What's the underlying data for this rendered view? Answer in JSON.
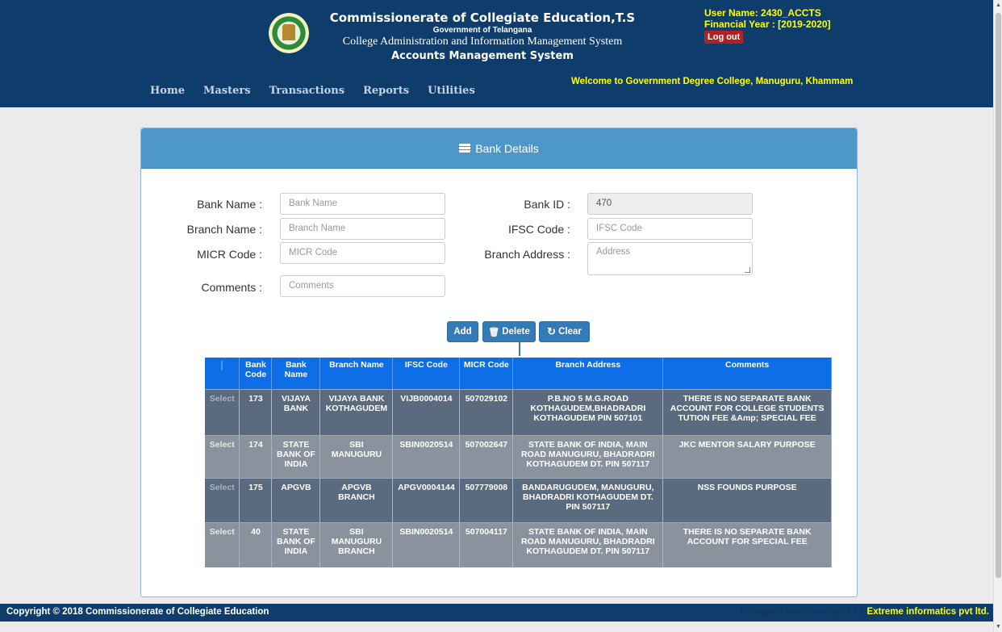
{
  "header": {
    "title": "Commissionerate of Collegiate Education,T.S",
    "government": "Government of Telangana",
    "system": "College Administration and Information Management System",
    "module": "Accounts Management System",
    "user_name": "User Name:  2430_ACCTS",
    "financial_year": "Financial Year :  [2019-2020]",
    "logout": "Log out",
    "welcome": "Welcome to  Government Degree College, Manuguru, Khammam"
  },
  "nav": [
    "Home",
    "Masters",
    "Transactions",
    "Reports",
    "Utilities"
  ],
  "panel": {
    "title": "Bank Details",
    "icon": "list-icon"
  },
  "form": {
    "bank_name": {
      "label": "Bank Name :",
      "placeholder": "Bank Name",
      "value": ""
    },
    "branch_name": {
      "label": "Branch Name :",
      "placeholder": "Branch Name",
      "value": ""
    },
    "micr_code": {
      "label": "MICR Code :",
      "placeholder": "MICR Code",
      "value": ""
    },
    "comments": {
      "label": "Comments :",
      "placeholder": "Comments",
      "value": ""
    },
    "bank_id": {
      "label": "Bank ID :",
      "value": "470"
    },
    "ifsc_code": {
      "label": "IFSC Code :",
      "placeholder": "IFSC Code",
      "value": ""
    },
    "branch_address": {
      "label": "Branch Address :",
      "placeholder": "Address",
      "value": ""
    }
  },
  "buttons": {
    "add": "Add",
    "delete": "Delete",
    "clear": "Clear"
  },
  "table": {
    "headers": [
      "",
      "Bank Code",
      "Bank Name",
      "Branch Name",
      "IFSC Code",
      "MICR Code",
      "Branch Address",
      "Comments"
    ],
    "select_label": "Select",
    "rows": [
      {
        "code": "173",
        "bank": "VIJAYA BANK",
        "branch": "VIJAYA BANK KOTHAGUDEM",
        "ifsc": "VIJB0004014",
        "micr": "507029102",
        "address": "P.B.NO 5 M.G.ROAD KOTHAGUDEM,BHADRADRI KOTHAGUDEM PIN 507101",
        "comments": "THERE IS NO SEPARATE BANK ACCOUNT FOR COLLEGE STUDENTS TUTION FEE &Amp; SPECIAL FEE"
      },
      {
        "code": "174",
        "bank": "STATE BANK OF INDIA",
        "branch": "SBI MANUGURU",
        "ifsc": "SBIN0020514",
        "micr": "507002647",
        "address": "STATE BANK OF INDIA, MAIN ROAD MANUGURU, BHADRADRI KOTHAGUDEM DT. PIN 507117",
        "comments": "JKC MENTOR SALARY PURPOSE"
      },
      {
        "code": "175",
        "bank": "APGVB",
        "branch": "APGVB BRANCH",
        "ifsc": "APGV0004144",
        "micr": "507779008",
        "address": "BANDARUGUDEM, MANUGURU, BHADRADRI KOTHAGUDEM DT. PIN 507117",
        "comments": "NSS FOUNDS PURPOSE"
      },
      {
        "code": "40",
        "bank": "STATE BANK OF INDIA",
        "branch": "SBI MANUGURU BRANCH",
        "ifsc": "SBIN0020514",
        "micr": "507004117",
        "address": "STATE BANK OF INDIA, MAIN ROAD MANUGURU, BHADRADRI KOTHAGUDEM DT. PIN 507117",
        "comments": "THERE IS NO SEPARATE BANK ACCOUNT FOR SPECIAL FEE"
      }
    ]
  },
  "footer": {
    "copyright": "Copyright © 2018 Commissionerate of Collegiate Education",
    "developed_by": "Designed and Developed by",
    "company": "Extreme informatics pvt ltd."
  }
}
